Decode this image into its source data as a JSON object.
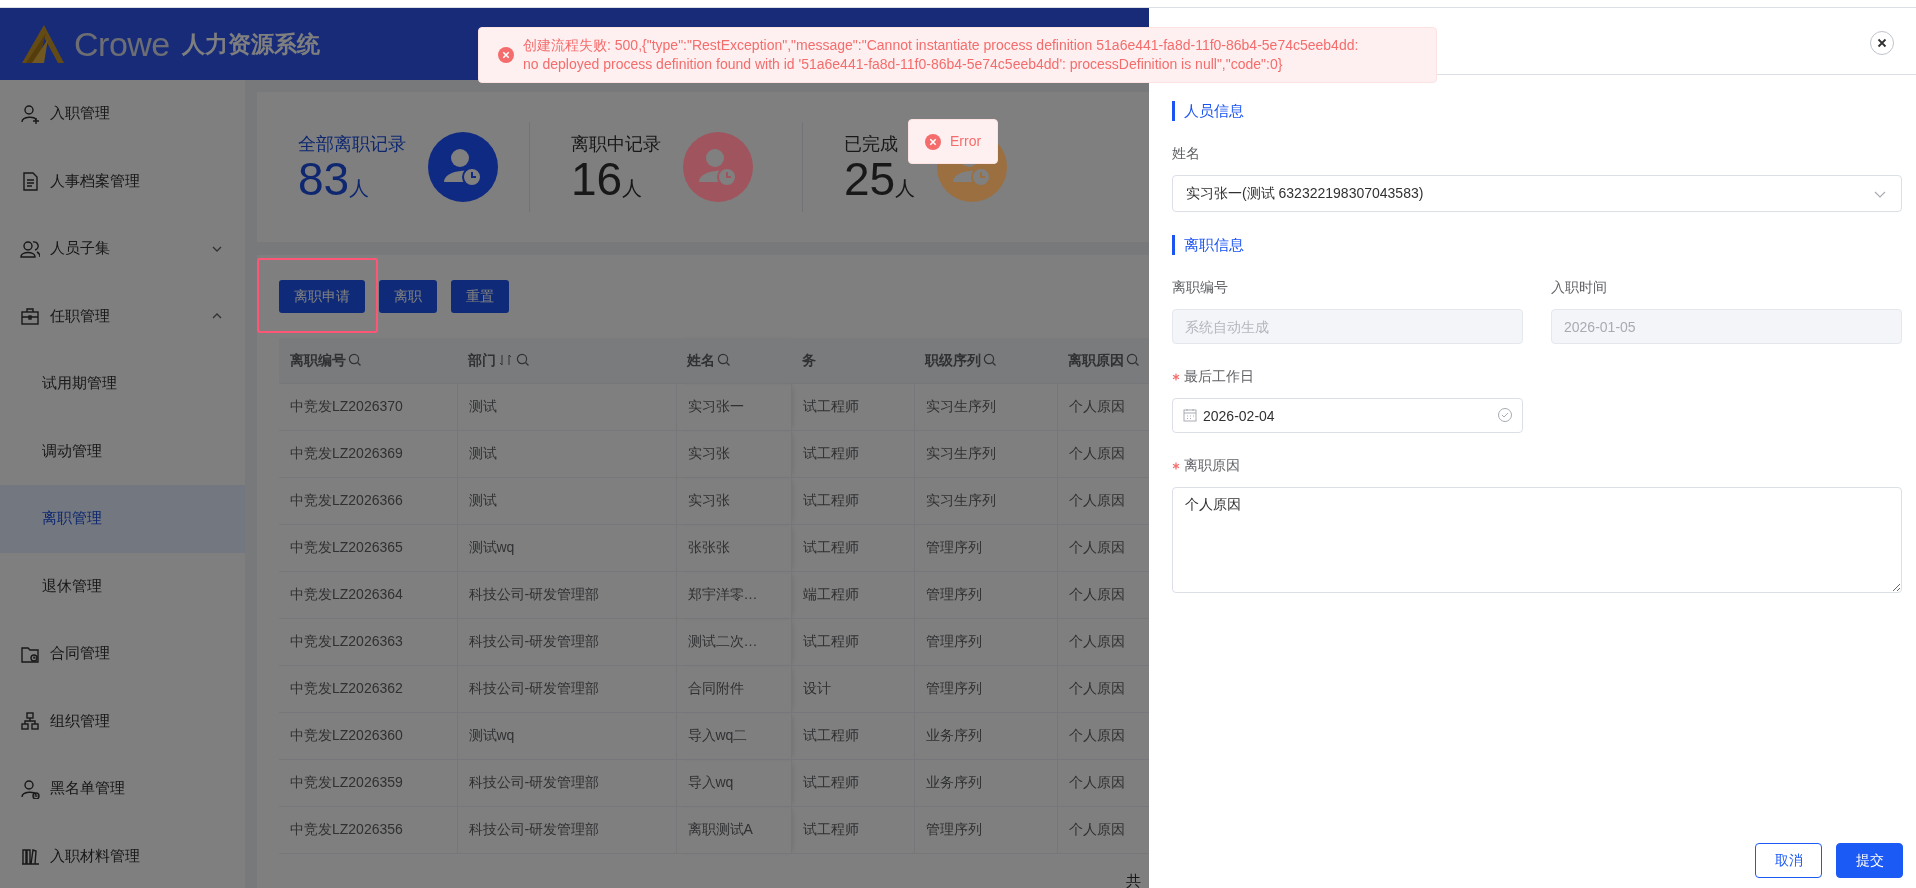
{
  "header": {
    "logo_text": "Crowe",
    "title": "人力资源系统"
  },
  "sidebar": {
    "items": [
      {
        "label": "入职管理",
        "selected": false
      },
      {
        "label": "人事档案管理",
        "selected": false
      },
      {
        "label": "人员子集",
        "selected": false,
        "expanded": false
      },
      {
        "label": "任职管理",
        "selected": false,
        "expanded": true,
        "children": [
          {
            "label": "试用期管理",
            "selected": false
          },
          {
            "label": "调动管理",
            "selected": false
          },
          {
            "label": "离职管理",
            "selected": true
          },
          {
            "label": "退休管理",
            "selected": false
          }
        ]
      },
      {
        "label": "合同管理",
        "selected": false
      },
      {
        "label": "组织管理",
        "selected": false
      },
      {
        "label": "黑名单管理",
        "selected": false
      },
      {
        "label": "入职材料管理",
        "selected": false
      }
    ]
  },
  "stats": [
    {
      "label": "全部离职记录",
      "value": "83",
      "unit": "人",
      "color": "#0f2a82",
      "selected": true
    },
    {
      "label": "离职中记录",
      "value": "16",
      "unit": "人",
      "color": "#a0555e",
      "selected": false
    },
    {
      "label": "已完成",
      "value": "25",
      "unit": "人",
      "color": "#9b6f40",
      "selected": false
    }
  ],
  "toolbar": {
    "buttons": [
      {
        "label": "离职申请",
        "highlighted": true
      },
      {
        "label": "离职",
        "highlighted": false
      },
      {
        "label": "重置",
        "highlighted": false
      }
    ]
  },
  "table": {
    "columns": [
      {
        "label": "离职编号",
        "filterable": true,
        "sortable": false
      },
      {
        "label": "部门",
        "filterable": true,
        "sortable": true
      },
      {
        "label": "姓名",
        "filterable": true,
        "sortable": false
      },
      {
        "label": "务",
        "filterable": false,
        "sortable": false
      },
      {
        "label": "职级序列",
        "filterable": true,
        "sortable": false
      },
      {
        "label": "离职原因",
        "filterable": true,
        "sortable": false
      }
    ],
    "rows": [
      [
        "中竞发LZ2026370",
        "测试",
        "实习张一",
        "试工程师",
        "实习生序列",
        "个人原因"
      ],
      [
        "中竞发LZ2026369",
        "测试",
        "实习张",
        "试工程师",
        "实习生序列",
        "个人原因"
      ],
      [
        "中竞发LZ2026366",
        "测试",
        "实习张",
        "试工程师",
        "实习生序列",
        "个人原因"
      ],
      [
        "中竞发LZ2026365",
        "测试wq",
        "张张张",
        "试工程师",
        "管理序列",
        "个人原因"
      ],
      [
        "中竞发LZ2026364",
        "科技公司-研发管理部",
        "郑宇洋零…",
        "端工程师",
        "管理序列",
        "个人原因"
      ],
      [
        "中竞发LZ2026363",
        "科技公司-研发管理部",
        "测试二次…",
        "试工程师",
        "管理序列",
        "个人原因"
      ],
      [
        "中竞发LZ2026362",
        "科技公司-研发管理部",
        "合同附件",
        "设计",
        "管理序列",
        "个人原因"
      ],
      [
        "中竞发LZ2026360",
        "测试wq",
        "导入wq二",
        "试工程师",
        "业务序列",
        "个人原因"
      ],
      [
        "中竞发LZ2026359",
        "科技公司-研发管理部",
        "导入wq",
        "试工程师",
        "业务序列",
        "个人原因"
      ],
      [
        "中竞发LZ2026356",
        "科技公司-研发管理部",
        "离职测试A",
        "试工程师",
        "管理序列",
        "个人原因"
      ]
    ]
  },
  "pagination": {
    "total_label": "共"
  },
  "drawer": {
    "form": [
      {
        "kind": "section",
        "title": "人员信息"
      },
      {
        "kind": "select",
        "label": "姓名",
        "value": "实习张一(测试 632322198307043583)",
        "required": false,
        "disabled": false
      },
      {
        "kind": "section",
        "title": "离职信息"
      },
      {
        "kind": "input",
        "label": "离职编号",
        "placeholder": "系统自动生成",
        "required": false,
        "disabled": true
      },
      {
        "kind": "input",
        "label": "入职时间",
        "value": "2026-01-05",
        "required": false,
        "disabled": true
      },
      {
        "kind": "date",
        "label": "最后工作日",
        "value": "2026-02-04",
        "required": true,
        "disabled": false
      },
      {
        "kind": "textarea",
        "label": "离职原因",
        "value": "个人原因",
        "required": true,
        "disabled": false
      }
    ],
    "buttons": [
      {
        "label": "取消",
        "kind": "secondary"
      },
      {
        "label": "提交",
        "kind": "primary"
      }
    ]
  },
  "toasts": [
    {
      "kind": "error",
      "message": "创建流程失败: 500,{\"type\":\"RestException\",\"message\":\"Cannot instantiate process definition 51a6e441-fa8d-11f0-86b4-5e74c5eeb4dd: no deployed process definition found with id '51a6e441-fa8d-11f0-86b4-5e74c5eeb4dd': processDefinition is null\",\"code\":0}"
    },
    {
      "kind": "error",
      "message": "Error"
    }
  ]
}
